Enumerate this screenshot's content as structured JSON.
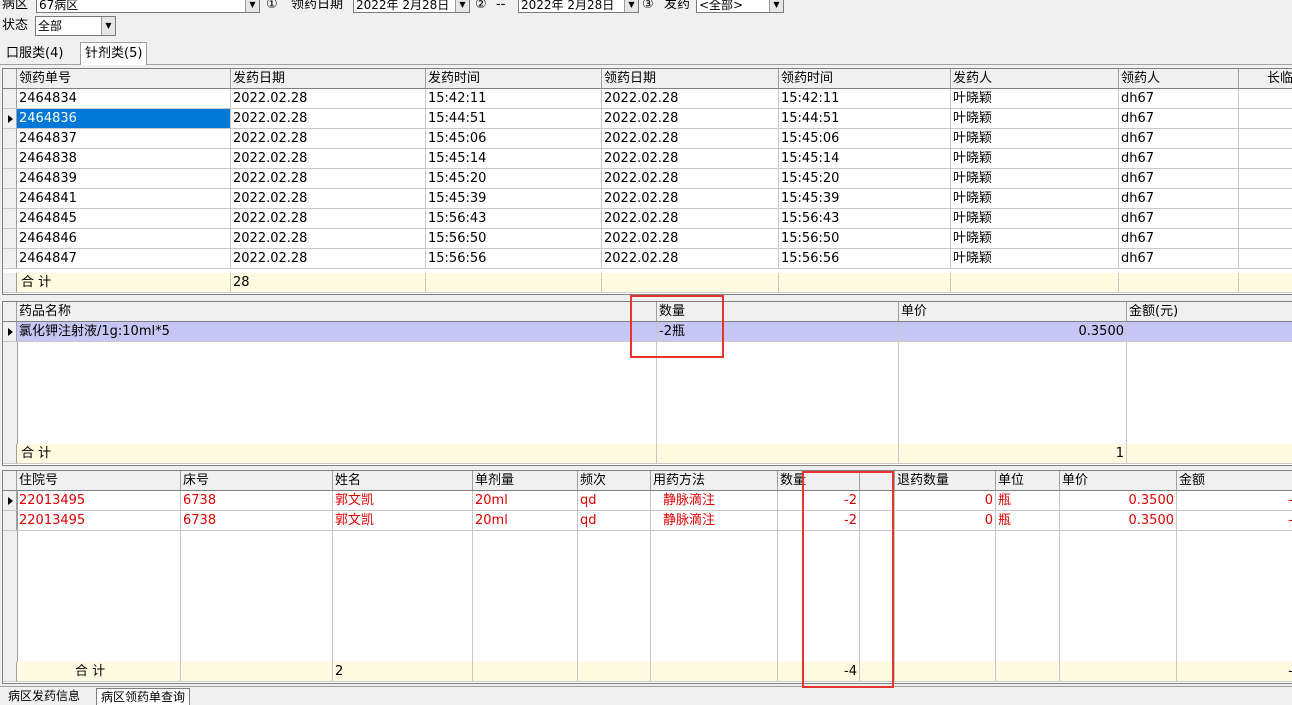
{
  "toolbar": {
    "ward_label": "病区",
    "ward_value": "67病区",
    "step1": "①",
    "date_label": "领药日期",
    "date_from": "2022年  2月28日",
    "step2": "②",
    "date_sep": "--",
    "date_to": "2022年  2月28日",
    "step3": "③",
    "dispense_label": "发药",
    "dispense_value": "<全部>",
    "status_label": "状态",
    "status_value": "全部"
  },
  "tabs": [
    {
      "label": "口服类(4)"
    },
    {
      "label": "针剂类(5)"
    }
  ],
  "grid1": {
    "headers": [
      "领药单号",
      "发药日期",
      "发药时间",
      "领药日期",
      "领药时间",
      "发药人",
      "领药人",
      "长临"
    ],
    "rows": [
      [
        "2464834",
        "2022.02.28",
        "15:42:11",
        "2022.02.28",
        "15:42:11",
        "叶晓颖",
        "dh67"
      ],
      [
        "2464836",
        "2022.02.28",
        "15:44:51",
        "2022.02.28",
        "15:44:51",
        "叶晓颖",
        "dh67"
      ],
      [
        "2464837",
        "2022.02.28",
        "15:45:06",
        "2022.02.28",
        "15:45:06",
        "叶晓颖",
        "dh67"
      ],
      [
        "2464838",
        "2022.02.28",
        "15:45:14",
        "2022.02.28",
        "15:45:14",
        "叶晓颖",
        "dh67"
      ],
      [
        "2464839",
        "2022.02.28",
        "15:45:20",
        "2022.02.28",
        "15:45:20",
        "叶晓颖",
        "dh67"
      ],
      [
        "2464841",
        "2022.02.28",
        "15:45:39",
        "2022.02.28",
        "15:45:39",
        "叶晓颖",
        "dh67"
      ],
      [
        "2464845",
        "2022.02.28",
        "15:56:43",
        "2022.02.28",
        "15:56:43",
        "叶晓颖",
        "dh67"
      ],
      [
        "2464846",
        "2022.02.28",
        "15:56:50",
        "2022.02.28",
        "15:56:50",
        "叶晓颖",
        "dh67"
      ],
      [
        "2464847",
        "2022.02.28",
        "15:56:56",
        "2022.02.28",
        "15:56:56",
        "叶晓颖",
        "dh67"
      ]
    ],
    "footer_label": "合  计",
    "footer_count": "28"
  },
  "grid2": {
    "headers": [
      "药品名称",
      "数量",
      "单价",
      "金额(元)"
    ],
    "rows": [
      [
        "氯化钾注射液/1g:10ml*5",
        "-2瓶",
        "0.3500",
        ""
      ]
    ],
    "footer_label": "合  计",
    "footer_value": "1"
  },
  "grid3": {
    "headers": [
      "住院号",
      "床号",
      "姓名",
      "单剂量",
      "频次",
      "用药方法",
      "数量",
      "",
      "退药数量",
      "单位",
      "单价",
      "金额"
    ],
    "rows": [
      [
        "22013495",
        "6738",
        "郭文凯",
        "20ml",
        "qd",
        "静脉滴注",
        "-2",
        "",
        "0",
        "瓶",
        "0.3500",
        "-"
      ],
      [
        "22013495",
        "6738",
        "郭文凯",
        "20ml",
        "qd",
        "静脉滴注",
        "-2",
        "",
        "0",
        "瓶",
        "0.3500",
        "-"
      ]
    ],
    "footer_label": "合  计",
    "footer_count": "2",
    "footer_qty": "-4",
    "footer_amount": "-"
  },
  "bottom_tabs": [
    {
      "label": "病区发药信息"
    },
    {
      "label": "病区领药单查询"
    }
  ],
  "colors": {
    "selected": "#0078d7",
    "row_selected": "#c6c6f5",
    "footer_bg": "#fffbe0",
    "red_text": "#e00000",
    "highlight_box": "#e8342c"
  }
}
